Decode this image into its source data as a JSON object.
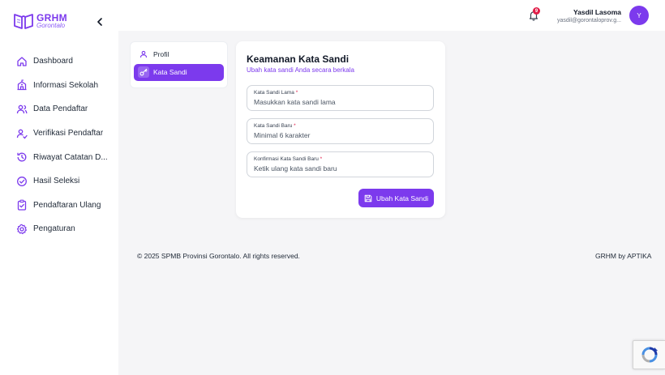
{
  "brand": {
    "title": "GRHM",
    "subtitle": "Gorontalo",
    "accent": "#7c3aed"
  },
  "sidebar": {
    "collapse_icon": "chevron-left-icon",
    "items": [
      {
        "label": "Dashboard",
        "icon": "home-icon"
      },
      {
        "label": "Informasi Sekolah",
        "icon": "school-icon"
      },
      {
        "label": "Data Pendaftar",
        "icon": "users-icon"
      },
      {
        "label": "Verifikasi Pendaftar",
        "icon": "user-check-icon"
      },
      {
        "label": "Riwayat Catatan D...",
        "icon": "history-icon"
      },
      {
        "label": "Hasil Seleksi",
        "icon": "check-circle-icon"
      },
      {
        "label": "Pendaftaran Ulang",
        "icon": "clipboard-check-icon"
      },
      {
        "label": "Pengaturan",
        "icon": "gear-icon"
      }
    ]
  },
  "header": {
    "notification_count": "9",
    "user_name": "Yasdil Lasoma",
    "user_email": "yasdil@gorontaloprov.g...",
    "avatar_initial": "Y"
  },
  "tabs": [
    {
      "label": "Profil",
      "icon": "user-icon",
      "active": false
    },
    {
      "label": "Kata Sandi",
      "icon": "key-icon",
      "active": true
    }
  ],
  "form": {
    "title": "Keamanan Kata Sandi",
    "subtitle": "Ubah kata sandi Anda secara berkala",
    "fields": [
      {
        "label": "Kata Sandi Lama",
        "required_mark": "*",
        "placeholder": "Masukkan kata sandi lama",
        "value": ""
      },
      {
        "label": "Kata Sandi Baru",
        "required_mark": "*",
        "placeholder": "Minimal 6 karakter",
        "value": ""
      },
      {
        "label": "Konfirmasi Kata Sandi Baru",
        "required_mark": "*",
        "placeholder": "Ketik ulang kata sandi baru",
        "value": ""
      }
    ],
    "submit_label": "Ubah Kata Sandi",
    "submit_icon": "save-icon"
  },
  "footer": {
    "copyright": "© 2025 SPMB Provinsi Gorontalo. All rights reserved.",
    "credit": "GRHM by APTIKA"
  }
}
